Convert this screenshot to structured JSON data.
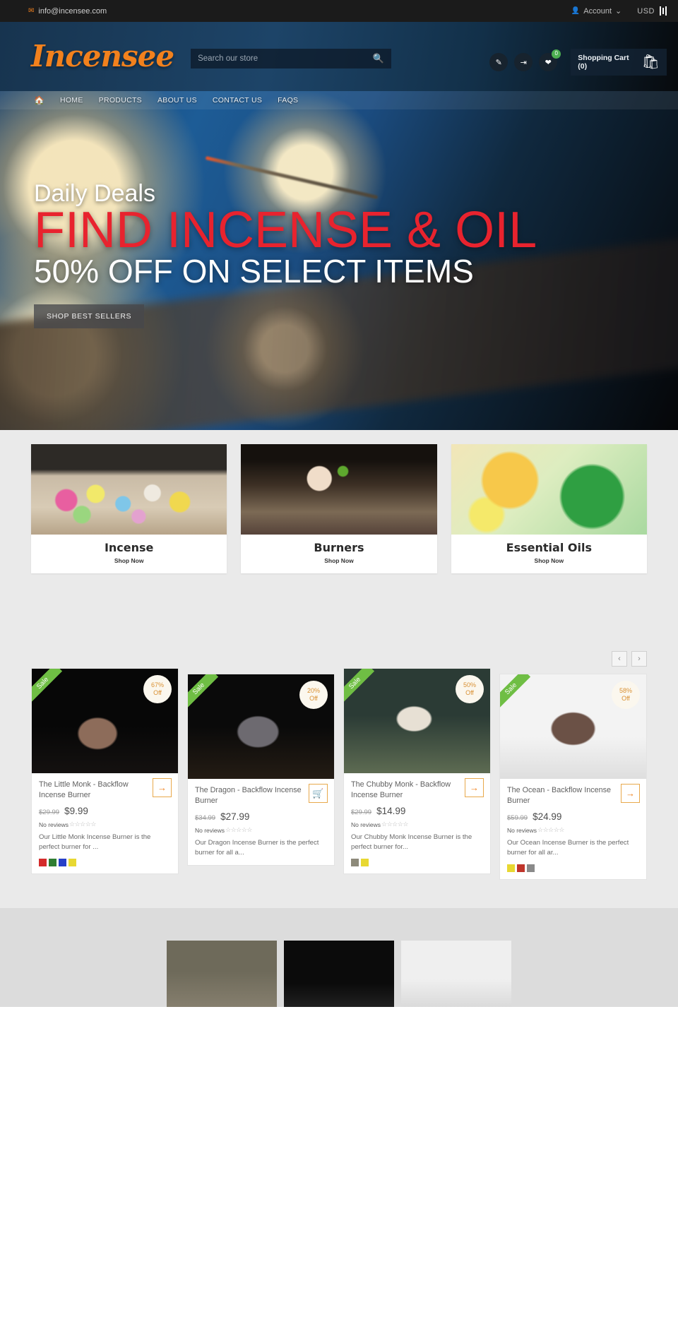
{
  "topbar": {
    "email": "info@incensee.com",
    "mail_icon": "envelope-icon",
    "account_label": "Account",
    "account_icon": "user-icon",
    "currency": "USD"
  },
  "header": {
    "logo": "Incensee",
    "search_placeholder": "Search our store",
    "search_value": "",
    "search_icon": "search-icon",
    "actions": [
      {
        "icon": "pencil-icon",
        "badge": ""
      },
      {
        "icon": "login-icon",
        "badge": ""
      },
      {
        "icon": "heart-icon",
        "badge": "0"
      }
    ],
    "cart_label": "Shopping Cart",
    "cart_count": "(0)",
    "cart_icon": "shopping-bag-icon"
  },
  "nav": {
    "home_icon": "home-icon",
    "items": [
      {
        "label": "HOME"
      },
      {
        "label": "PRODUCTS"
      },
      {
        "label": "ABOUT US"
      },
      {
        "label": "CONTACT US"
      },
      {
        "label": "FAQS"
      }
    ]
  },
  "hero": {
    "kicker": "Daily Deals",
    "title": "FIND INCENSE & OIL",
    "subtitle": "50% OFF ON SELECT ITEMS",
    "button": "SHOP BEST SELLERS",
    "title_color": "#e8232e"
  },
  "categories": {
    "shop_now": "Shop Now",
    "items": [
      {
        "title": "Incense",
        "shop": "Shop Now"
      },
      {
        "title": "Burners",
        "shop": "Shop Now"
      },
      {
        "title": "Essential Oils",
        "shop": "Shop Now"
      }
    ]
  },
  "carousel": {
    "prev_icon": "chevron-left-icon",
    "prev": "‹",
    "next_icon": "chevron-right-icon",
    "next": "›"
  },
  "products": [
    {
      "ribbon": "Sale",
      "discount_pct": "67%",
      "discount_suffix": "Off",
      "title": "The Little Monk - Backflow Incense Burner",
      "old_price": "$29.99",
      "new_price": "$9.99",
      "reviews": "No reviews",
      "stars": "☆☆☆☆☆",
      "desc": "Our Little Monk Incense Burner is the perfect burner for ...",
      "action_icon": "arrow-right-icon",
      "action_glyph": "→",
      "swatches": [
        "#d42b2b",
        "#2f7d32",
        "#2740c8",
        "#e8d832"
      ]
    },
    {
      "ribbon": "Sale",
      "discount_pct": "20%",
      "discount_suffix": "Off",
      "title": "The Dragon - Backflow Incense Burner",
      "old_price": "$34.99",
      "new_price": "$27.99",
      "reviews": "No reviews",
      "stars": "☆☆☆☆☆",
      "desc": "Our Dragon Incense Burner is the perfect burner for all a...",
      "action_icon": "shopping-cart-icon",
      "action_glyph": "🛒",
      "swatches": []
    },
    {
      "ribbon": "Sale",
      "discount_pct": "50%",
      "discount_suffix": "Off",
      "title": "The Chubby Monk - Backflow Incense Burner",
      "old_price": "$29.99",
      "new_price": "$14.99",
      "reviews": "No reviews",
      "stars": "☆☆☆☆☆",
      "desc": "Our Chubby Monk Incense Burner is the perfect burner for...",
      "action_icon": "arrow-right-icon",
      "action_glyph": "→",
      "swatches": [
        "#8d8a7a",
        "#e8d832"
      ]
    },
    {
      "ribbon": "Sale",
      "discount_pct": "58%",
      "discount_suffix": "Off",
      "title": "The Ocean - Backflow Incense Burner",
      "old_price": "$59.99",
      "new_price": "$24.99",
      "reviews": "No reviews",
      "stars": "☆☆☆☆☆",
      "desc": "Our Ocean Incense Burner is the perfect burner for all ar...",
      "action_icon": "arrow-right-icon",
      "action_glyph": "→",
      "swatches": [
        "#e8d832",
        "#c0352b",
        "#8a8a8a"
      ]
    }
  ]
}
